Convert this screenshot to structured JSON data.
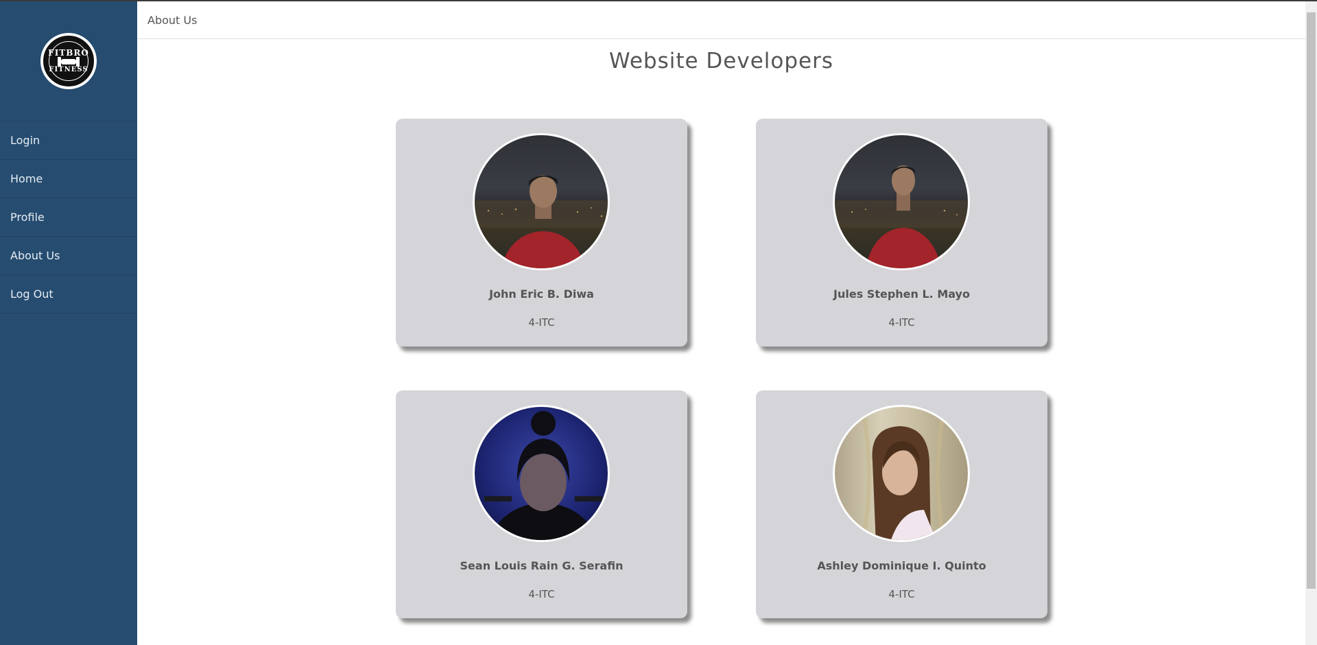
{
  "sidebar": {
    "logo": {
      "top_text": "FITBRO",
      "bottom_text": "FITNESS"
    },
    "items": [
      {
        "label": "Login"
      },
      {
        "label": "Home"
      },
      {
        "label": "Profile"
      },
      {
        "label": "About Us"
      },
      {
        "label": "Log Out"
      }
    ]
  },
  "topbar": {
    "title": "About Us"
  },
  "page": {
    "heading": "Website Developers"
  },
  "developers": [
    {
      "name": "John Eric B. Diwa",
      "section": "4-ITC",
      "photo": "portrait-city-night"
    },
    {
      "name": "Jules Stephen L. Mayo",
      "section": "4-ITC",
      "photo": "portrait-city-night"
    },
    {
      "name": "Sean Louis Rain G. Serafin",
      "section": "4-ITC",
      "photo": "portrait-blue-room"
    },
    {
      "name": "Ashley Dominique I. Quinto",
      "section": "4-ITC",
      "photo": "portrait-warm-curtain"
    }
  ],
  "colors": {
    "sidebar_bg": "#264c70",
    "card_bg": "#d4d4d9",
    "text": "#555555"
  }
}
